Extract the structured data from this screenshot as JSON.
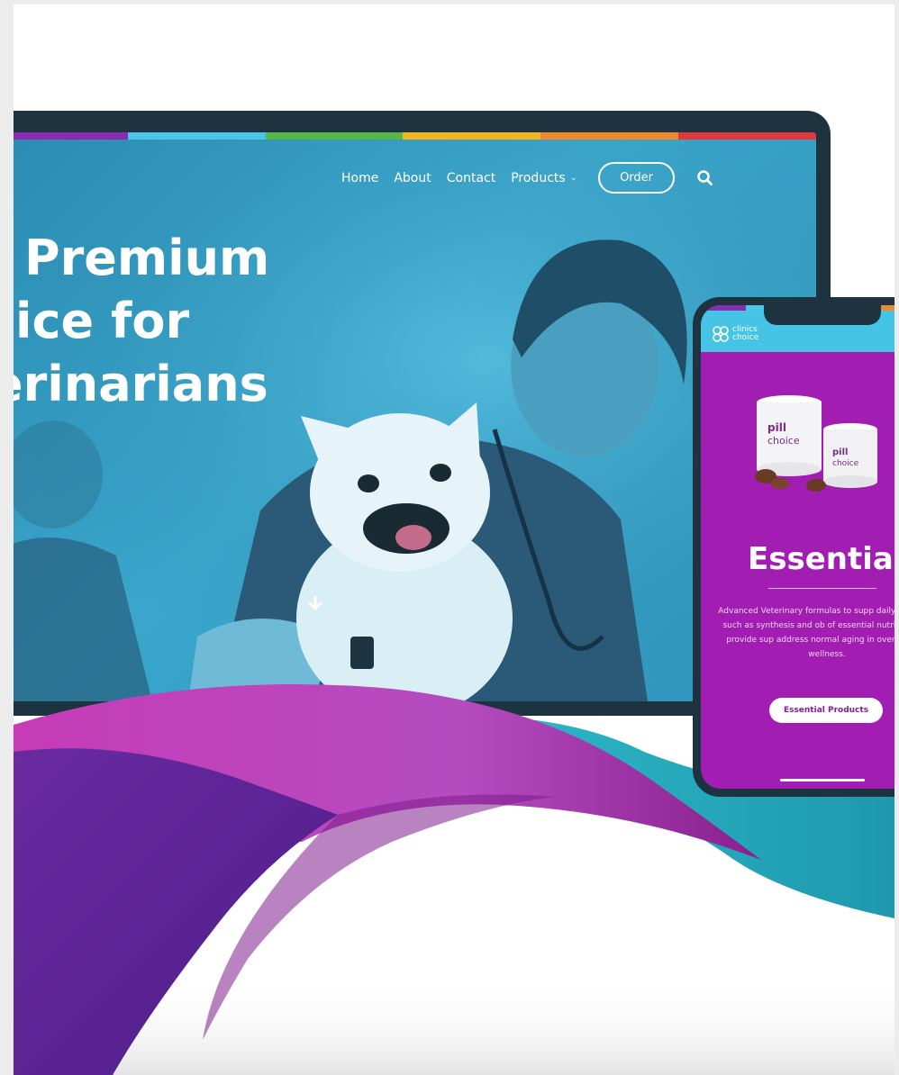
{
  "colors": {
    "strip": [
      "#8a2bb0",
      "#4cc3e8",
      "#56b748",
      "#f2b51f",
      "#ef8a2a",
      "#e0393b"
    ],
    "brand_purple": "#a21db2",
    "brand_teal": "#46c4e6",
    "frame": "#1e3340"
  },
  "desktop": {
    "nav": {
      "home": "Home",
      "about": "About",
      "contact": "Contact",
      "products": "Products",
      "products_caret": "⌄",
      "order": "Order",
      "search_icon": "search-icon"
    },
    "hero": {
      "line1": "Premium",
      "line2": "ice for",
      "line3": "erinarians"
    },
    "scroll_icon": "arrow-down-icon"
  },
  "mobile": {
    "brand_line1": "clinics",
    "brand_line2": "choice",
    "product_label": "pill choice",
    "section_title": "Essential",
    "description": "Advanced Veterinary formulas to supp daily functions such as synthesis and ob of essential nutrients and provide sup address normal aging in overall healt wellness.",
    "button": "Essential Products"
  }
}
